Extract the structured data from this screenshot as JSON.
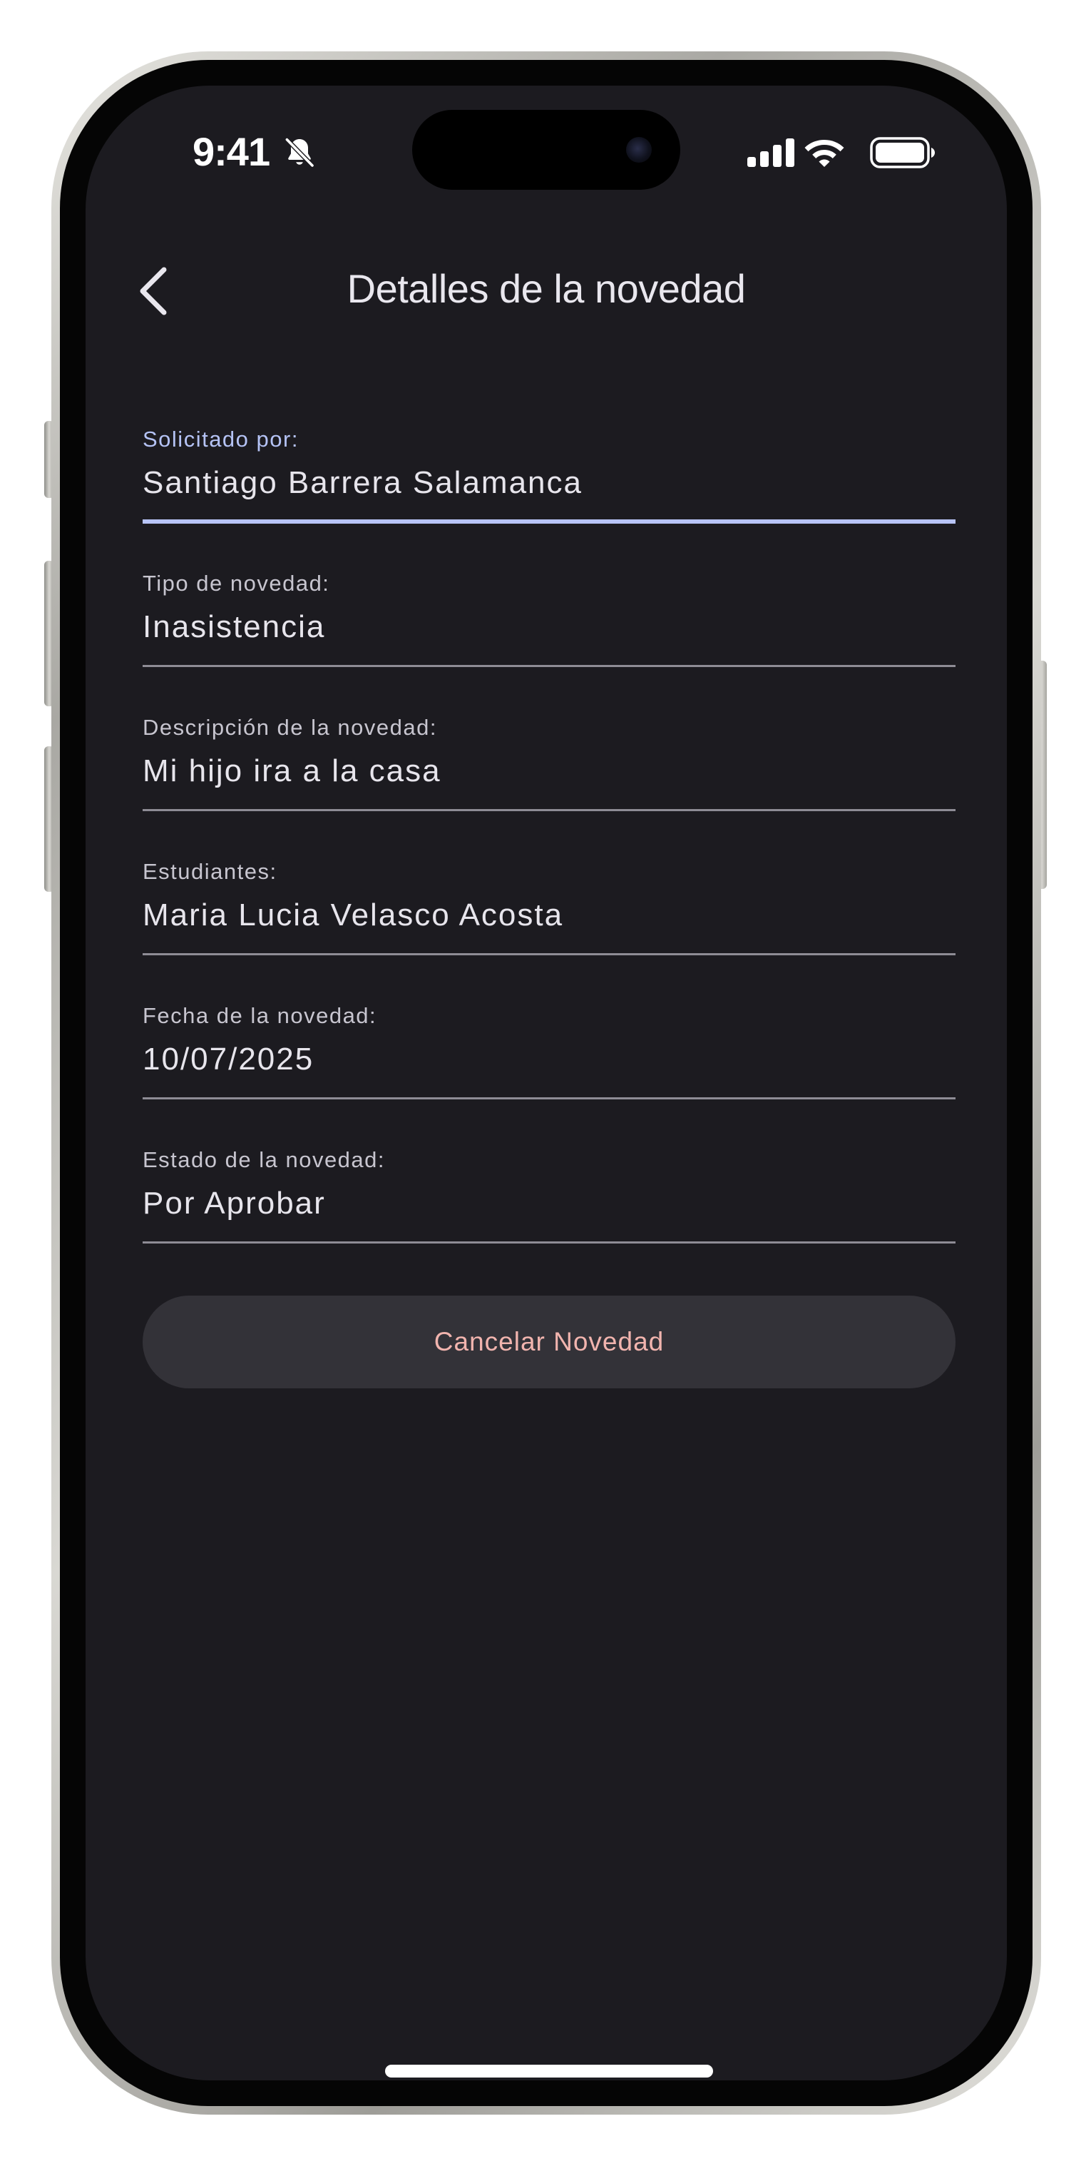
{
  "status_bar": {
    "time": "9:41",
    "icons": [
      "bell-slash-icon",
      "cellular-signal-icon",
      "wifi-icon",
      "battery-icon"
    ]
  },
  "header": {
    "back_icon": "chevron-left-icon",
    "title": "Detalles de la novedad"
  },
  "fields": [
    {
      "label": "Solicitado por:",
      "value": "Santiago Barrera Salamanca",
      "focused": true
    },
    {
      "label": "Tipo de novedad:",
      "value": "Inasistencia"
    },
    {
      "label": "Descripción de la novedad:",
      "value": "Mi hijo ira a la casa"
    },
    {
      "label": "Estudiantes:",
      "value": "Maria Lucia Velasco Acosta"
    },
    {
      "label": "Fecha de la novedad:",
      "value": "10/07/2025"
    },
    {
      "label": "Estado de la novedad:",
      "value": "Por Aprobar"
    }
  ],
  "actions": {
    "cancel_label": "Cancelar Novedad"
  },
  "colors": {
    "background": "#1c1b20",
    "accent": "#b8c4f7",
    "danger_text": "#f1b4ae",
    "button_bg": "#333238"
  }
}
